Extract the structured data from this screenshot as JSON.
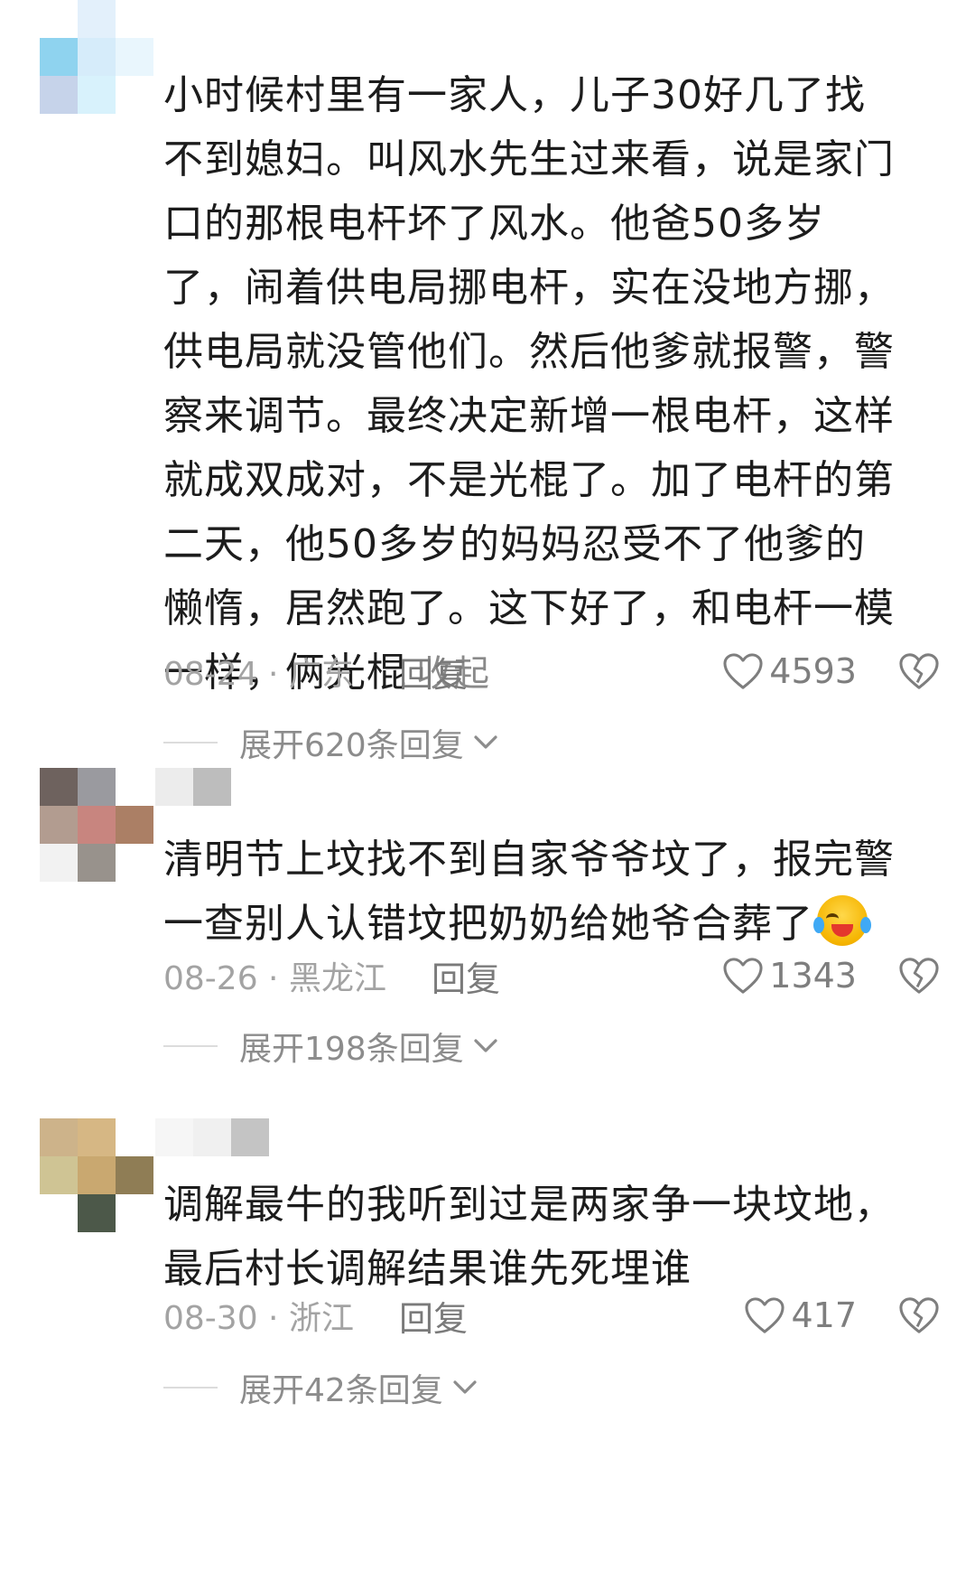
{
  "comments": [
    {
      "text": "小时候村里有一家人，儿子30好几了找不到媳妇。叫风水先生过来看，说是家门口的那根电杆坏了风水。他爸50多岁了，闹着供电局挪电杆，实在没地方挪，供电局就没管他们。然后他爹就报警，警察来调节。最终决定新增一根电杆，这样就成双成对，不是光棍了。加了电杆的第二天，他50多岁的妈妈忍受不了他爹的懒惰，居然跑了。这下好了，和电杆一模一样，俩光棍",
      "collapse_label": "收起",
      "date_location": "08-24 · 广东",
      "reply_label": "回复",
      "likes": "4593",
      "expand_label": "展开620条回复"
    },
    {
      "text": "清明节上坟找不到自家爷爷坟了，报完警一查别人认错坟把奶奶给她爷合葬了",
      "emoji": "laughing-crying-emoji",
      "date_location": "08-26 · 黑龙江",
      "reply_label": "回复",
      "likes": "1343",
      "expand_label": "展开198条回复"
    },
    {
      "text": "调解最牛的我听到过是两家争一块坟地，最后村长调解结果谁先死埋谁",
      "date_location": "08-30 · 浙江",
      "reply_label": "回复",
      "likes": "417",
      "expand_label": "展开42条回复"
    }
  ],
  "icons": {
    "like": "heart-icon",
    "dislike": "broken-heart-icon",
    "expand": "chevron-down-icon"
  },
  "colors": {
    "text": "#1c1c1c",
    "meta": "#a3a3a3",
    "reply": "#7a7a7a",
    "collapse": "#8a8a8a"
  }
}
